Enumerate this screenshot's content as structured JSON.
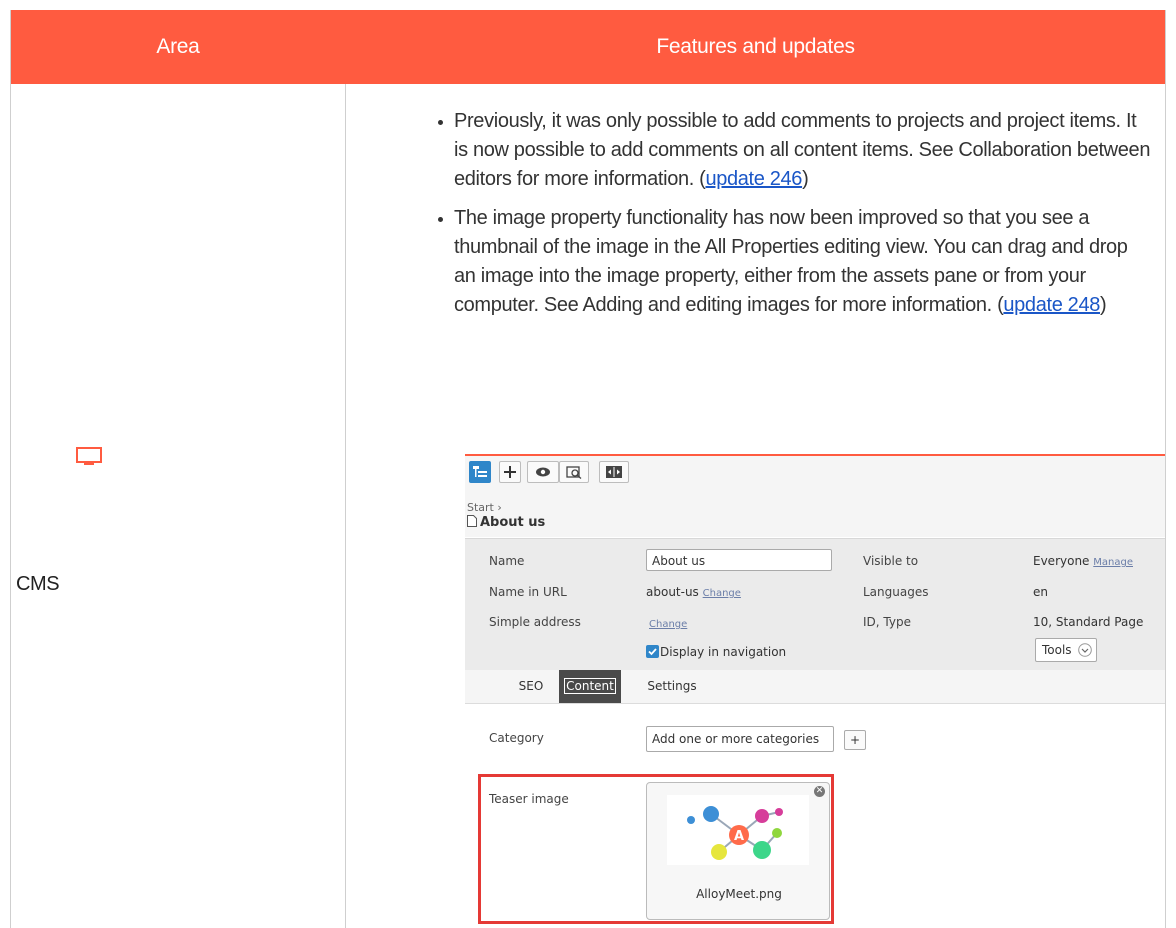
{
  "header": {
    "area_label": "Area",
    "features_label": "Features and updates"
  },
  "row": {
    "area_icon": "monitor-icon",
    "area_name": "CMS",
    "bullets": [
      {
        "text": "Previously, it was only possible to add comments to projects and project items. It is now possible to add comments on all content items. See Collaboration between editors for more information. (",
        "link": "update 246",
        "tail": ")"
      },
      {
        "text": "The image property functionality has now been improved so that you see a thumbnail of the image in the All Properties editing view. You can drag and drop an image into the image property, either from the assets pane or from your computer. See Adding and editing images for more information. (",
        "link": "update 248",
        "tail": ")"
      }
    ]
  },
  "screenshot": {
    "toolbar_icons": [
      "tree-icon",
      "add-icon",
      "preview-icon",
      "compare-icon",
      "sidebyside-icon"
    ],
    "breadcrumb": {
      "start": "Start",
      "page": "About us"
    },
    "properties": {
      "name_label": "Name",
      "name_value": "About us",
      "url_label": "Name in URL",
      "url_value": "about-us",
      "url_change": "Change",
      "simple_label": "Simple address",
      "simple_change": "Change",
      "nav_label": "Display in navigation",
      "visible_label": "Visible to",
      "visible_value": "Everyone",
      "visible_manage": "Manage",
      "lang_label": "Languages",
      "lang_value": "en",
      "id_label": "ID, Type",
      "id_value": "10, Standard Page",
      "tools_label": "Tools"
    },
    "tabs": [
      "SEO",
      "Content",
      "Settings"
    ],
    "active_tab": "Content",
    "content": {
      "category_label": "Category",
      "category_placeholder": "Add one or more categories",
      "add_label": "+",
      "teaser_label": "Teaser image",
      "image_name": "AlloyMeet.png",
      "image_logo_letter": "A"
    }
  },
  "colors": {
    "accent": "#ff5b40",
    "link": "#1a56c7",
    "highlight": "#e53935",
    "checkbox": "#2f86c9"
  }
}
